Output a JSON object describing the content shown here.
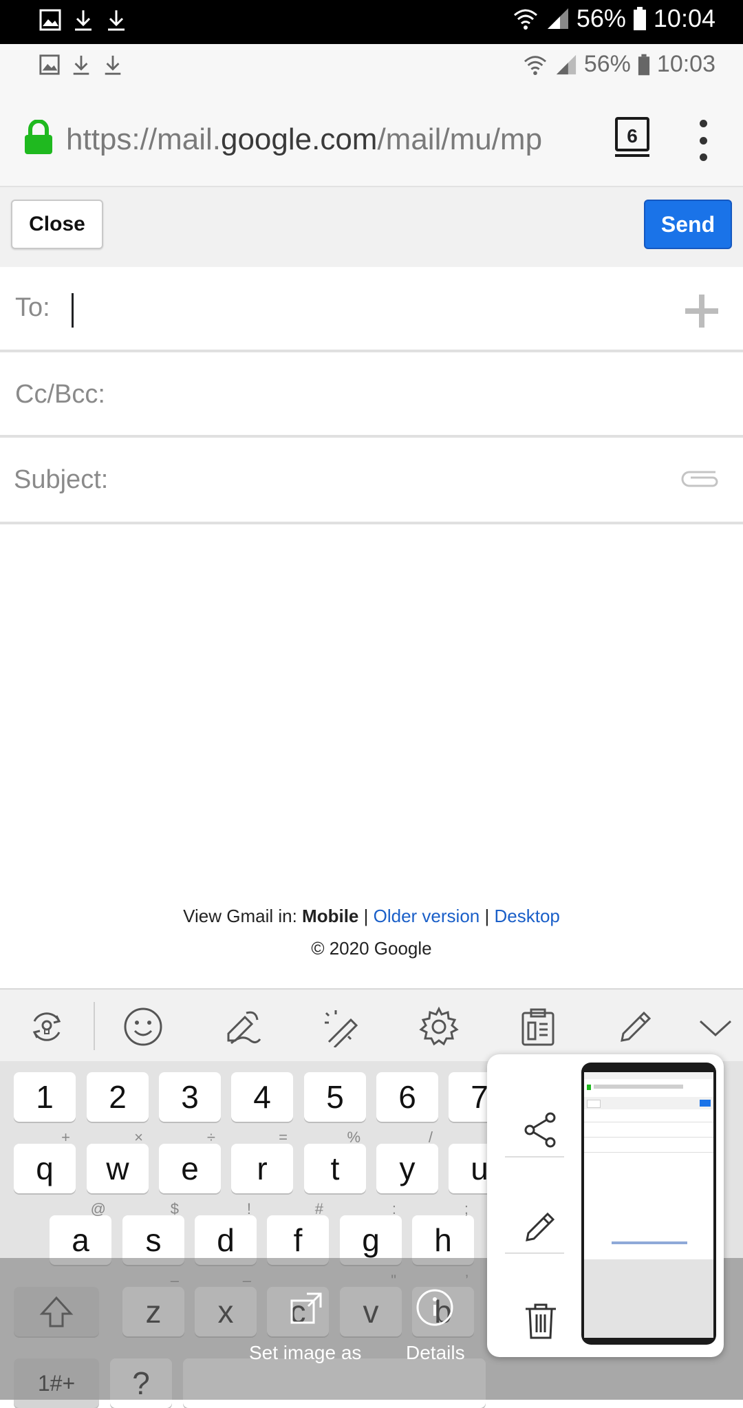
{
  "status_bar_top": {
    "battery": "56%",
    "time": "10:04",
    "icons": [
      "image-icon",
      "download-icon",
      "download-icon",
      "wifi-icon",
      "signal-icon",
      "battery-icon"
    ]
  },
  "status_bar_inner": {
    "battery": "56%",
    "time": "10:03",
    "icons": [
      "image-icon",
      "download-icon",
      "download-icon",
      "wifi-icon",
      "signal-icon",
      "battery-icon"
    ]
  },
  "browser": {
    "url_prefix": "https://mail.",
    "url_host": "google.com",
    "url_suffix": "/mail/mu/mp",
    "tab_count": "6",
    "icons": [
      "lock-icon",
      "tabs-icon",
      "more-vert-icon"
    ]
  },
  "compose": {
    "close_label": "Close",
    "send_label": "Send",
    "to_label": "To:",
    "to_value": "",
    "cc_label": "Cc/Bcc:",
    "subject_label": "Subject:",
    "icons": [
      "plus-icon",
      "paperclip-icon"
    ]
  },
  "footer": {
    "view_in": "View Gmail in:",
    "mobile": "Mobile",
    "sep": "|",
    "older": "Older version",
    "desktop": "Desktop",
    "copyright": "© 2020 Google"
  },
  "keyboard": {
    "toolbar_icons": [
      "translate-icon",
      "emoji-icon",
      "handwriting-icon",
      "magic-pen-icon",
      "settings-icon",
      "clipboard-icon",
      "pen-icon",
      "chevron-down-icon"
    ],
    "row1": [
      "1",
      "2",
      "3",
      "4",
      "5",
      "6",
      "7"
    ],
    "row2": [
      {
        "k": "q",
        "s": "+"
      },
      {
        "k": "w",
        "s": "×"
      },
      {
        "k": "e",
        "s": "÷"
      },
      {
        "k": "r",
        "s": "="
      },
      {
        "k": "t",
        "s": "%"
      },
      {
        "k": "y",
        "s": "/"
      },
      {
        "k": "u",
        "s": ""
      }
    ],
    "row3": [
      {
        "k": "a",
        "s": "@"
      },
      {
        "k": "s",
        "s": "$"
      },
      {
        "k": "d",
        "s": "!"
      },
      {
        "k": "f",
        "s": "#"
      },
      {
        "k": "g",
        "s": ":"
      },
      {
        "k": "h",
        "s": ";"
      }
    ],
    "row4": [
      {
        "k": "z",
        "s": "–"
      },
      {
        "k": "x",
        "s": "–"
      },
      {
        "k": "c",
        "s": ""
      },
      {
        "k": "v",
        "s": "\""
      },
      {
        "k": "b",
        "s": "’"
      }
    ],
    "sym_label": "1#+",
    "q_label": "?"
  },
  "overlay": {
    "set_image_label": "Set image as",
    "details_label": "Details",
    "popup_icons": [
      "share-icon",
      "edit-icon",
      "delete-icon"
    ]
  }
}
